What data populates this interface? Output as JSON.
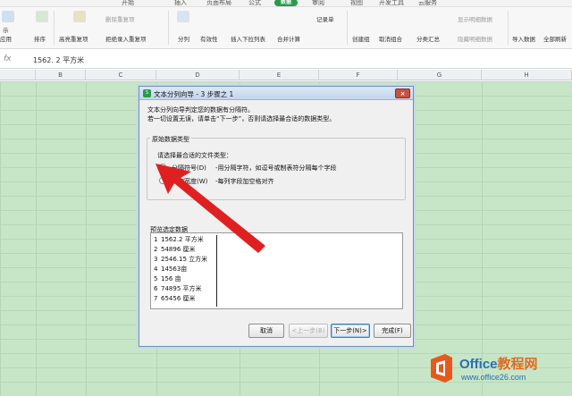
{
  "ribbon": {
    "tabs": [
      "开始",
      "插入",
      "页面布局",
      "公式",
      "数据",
      "审阅",
      "视图",
      "开发工具",
      "云服务"
    ],
    "active_tab": "数据",
    "groups": {
      "col1_top": "示",
      "col1_bottom": "应用",
      "col2_top": "排序",
      "col2_bottom": "排序",
      "highlight_dup": "高亮重复项",
      "delete_dup": "删除重复项",
      "reject_dup": "拒绝录入重复项",
      "split": "分列",
      "validity": "有效性",
      "insert_dropdown": "插入下拉列表",
      "merge_calc": "合并计算",
      "record_sheet": "记录单",
      "create_group": "创建组",
      "ungroup": "取消组合",
      "subtotal": "分类汇总",
      "show_detail": "显示明细数据",
      "hide_detail": "隐藏明细数据",
      "import_data": "导入数据",
      "refresh_all": "全部刷新"
    }
  },
  "formula_bar": {
    "fx": "fx",
    "value": "1562. 2  平方米"
  },
  "columns": [
    "B",
    "C",
    "D",
    "E",
    "F",
    "G",
    "H"
  ],
  "dialog": {
    "title": "文本分列向导 - 3 步骤之 1",
    "desc1": "文本分列向导判定您的数据有分隔符。",
    "desc2": "若一切设置无误，请单击“下一步”，否则请选择最合适的数据类型。",
    "group_title": "原始数据类型",
    "prompt": "请选择最合适的文件类型：",
    "option1_label": "分隔符号(D)",
    "option1_desc": "-用分隔字符，如逗号或制表符分隔每个字段",
    "option2_label": "固定宽度(W)",
    "option2_desc": "-每列字段加空格对齐",
    "preview_label": "预览选定数据",
    "preview_rows": [
      {
        "n": "1",
        "text": "1562.2  平方米"
      },
      {
        "n": "2",
        "text": "54896  厘米"
      },
      {
        "n": "3",
        "text": "2546.15  立方米"
      },
      {
        "n": "4",
        "text": "14563亩"
      },
      {
        "n": "5",
        "text": "156  亩"
      },
      {
        "n": "6",
        "text": "74895  平方米"
      },
      {
        "n": "7",
        "text": "65456  厘米"
      }
    ],
    "buttons": {
      "cancel": "取消",
      "prev": "<上一步(B)",
      "next": "下一步(N)>",
      "finish": "完成(F)"
    },
    "close": "×"
  },
  "watermark": {
    "brand_main": "Office",
    "brand_cn": "教程网",
    "url": "www.office26.com"
  },
  "colors": {
    "accent": "#2a9a4a",
    "sheet_bg": "#c7e6c8",
    "arrow": "#e02020"
  }
}
